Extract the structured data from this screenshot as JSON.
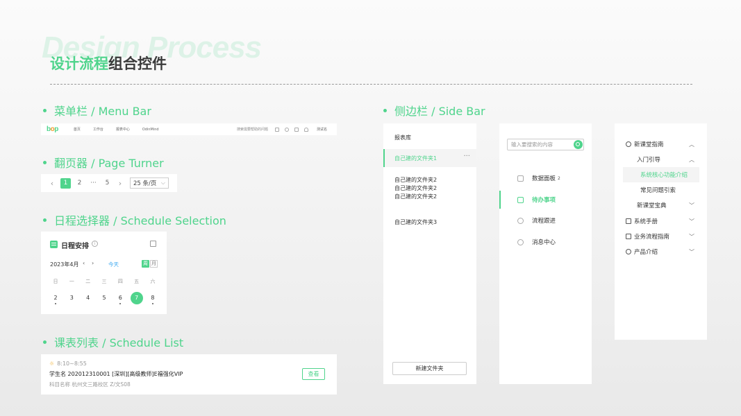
{
  "page": {
    "watermark": "Design Process",
    "title_highlight": "设计流程",
    "title_rest": "组合控件"
  },
  "sections": {
    "menu_bar": "菜单栏 / Menu Bar",
    "page_turner": "翻页器 / Page Turner",
    "schedule_selection": "日程选择器 / Schedule Selection",
    "schedule_list": "课表列表 / Schedule List",
    "side_bar": "侧边栏 / Side Bar"
  },
  "colors": {
    "accent": "#4fd48c",
    "link": "#3aa7f0",
    "logo_o": "#f39a2b"
  },
  "menu_bar": {
    "logo_a": "b",
    "logo_o": "o",
    "logo_b": "p",
    "items": [
      "首页",
      "工作台",
      "报表中心",
      "OdinMind"
    ],
    "search": "搜索需要帮助的问题",
    "icons": [
      "grid-icon",
      "help-icon",
      "message-icon",
      "bell-icon"
    ],
    "user": "测试名"
  },
  "pager": {
    "prev": "‹",
    "next": "›",
    "pages": [
      "1",
      "2",
      "···",
      "5"
    ],
    "current": "1",
    "page_size": "25 条/页",
    "chevron": "⌵"
  },
  "schedule": {
    "title": "日程安排",
    "info": "i",
    "month": "2023年4月",
    "prev": "‹",
    "next": "›",
    "today": "今天",
    "week_btn": "周",
    "month_btn": "月",
    "weekdays": [
      "日",
      "一",
      "二",
      "三",
      "四",
      "五",
      "六"
    ],
    "dates": [
      "2",
      "3",
      "4",
      "5",
      "6",
      "7",
      "8"
    ],
    "selected": "7"
  },
  "schedule_list": {
    "time": "8:10~8:55",
    "sun": "☼",
    "line1": "学生名  202012310001  [深圳][高级教师]E福强化VIP",
    "line2": "科目名称  杭州文三路校区  Z/文S08",
    "view": "查看"
  },
  "sidebar1": {
    "header": "报表库",
    "active": "自己建的文件夹1",
    "more": "···",
    "items": [
      "自己建的文件夹2",
      "自己建的文件夹2",
      "自己建的文件夹2",
      "自己建的文件夹3"
    ],
    "new_button": "新建文件夹"
  },
  "sidebar2": {
    "search_placeholder": "输入要搜索的内容",
    "items": [
      {
        "label": "数据面板",
        "badge": "2",
        "icon": "dashboard-icon"
      },
      {
        "label": "待办事项",
        "badge": "",
        "icon": "todo-icon"
      },
      {
        "label": "流程跟进",
        "badge": "",
        "icon": "clock-icon"
      },
      {
        "label": "消息中心",
        "badge": "",
        "icon": "message-icon"
      }
    ],
    "active": "待办事项"
  },
  "sidebar3": {
    "items": [
      {
        "label": "新课堂指南",
        "chev": "︿"
      },
      {
        "label": "入门引导",
        "chev": "︿"
      },
      {
        "label": "系统核心功能介绍",
        "chev": ""
      },
      {
        "label": "常见问题引索",
        "chev": ""
      },
      {
        "label": "新课堂宝典",
        "chev": "﹀"
      },
      {
        "label": "系统手册",
        "chev": "﹀"
      },
      {
        "label": "业务流程指南",
        "chev": "﹀"
      },
      {
        "label": "产品介绍",
        "chev": "﹀"
      }
    ]
  }
}
